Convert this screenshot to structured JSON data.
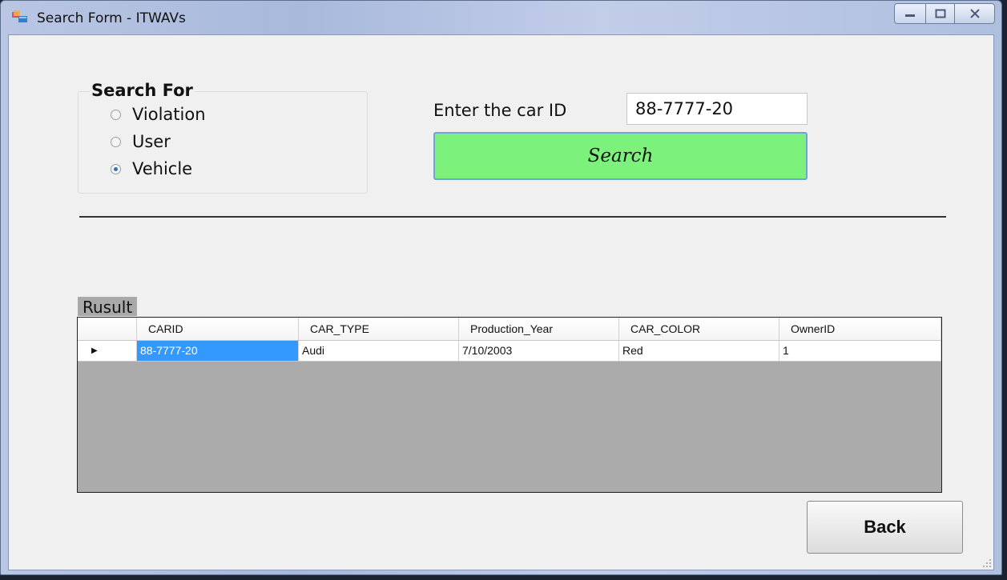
{
  "window": {
    "title": "Search Form - ITWAVs"
  },
  "search_group": {
    "title": "Search For",
    "options": [
      {
        "label": "Violation",
        "checked": false
      },
      {
        "label": "User",
        "checked": false
      },
      {
        "label": "Vehicle",
        "checked": true
      }
    ]
  },
  "car_id": {
    "label": "Enter the car ID",
    "value": "88-7777-20"
  },
  "search_button": {
    "label": "Search"
  },
  "result": {
    "label": "Rusult",
    "columns": [
      "CARID",
      "CAR_TYPE",
      "Production_Year",
      "CAR_COLOR",
      "OwnerID"
    ],
    "rows": [
      [
        "88-7777-20",
        "Audi",
        "7/10/2003",
        "Red",
        "1"
      ]
    ]
  },
  "back_button": {
    "label": "Back"
  },
  "colors": {
    "search_button": "#7cf27c",
    "selected_cell": "#3399ff",
    "grid_background": "#ababab"
  }
}
